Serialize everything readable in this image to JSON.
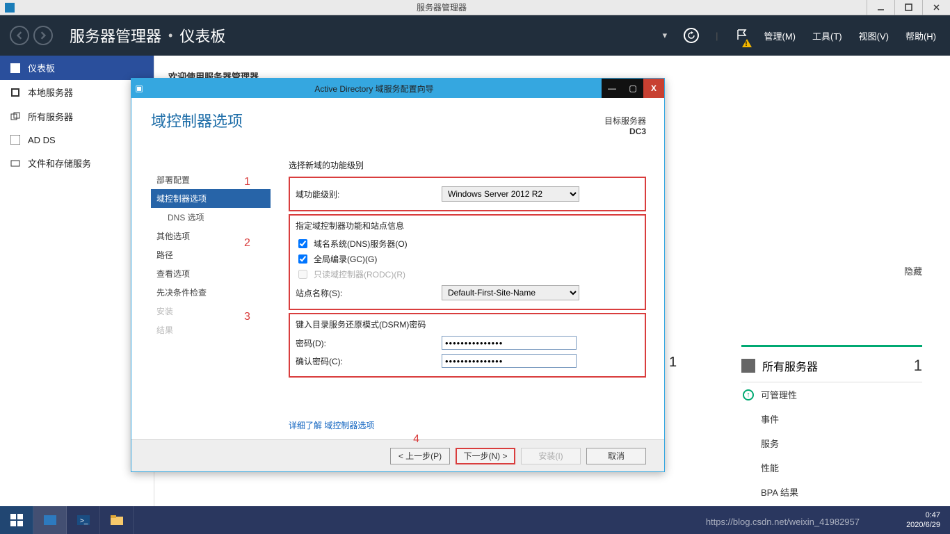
{
  "os_title": "服务器管理器",
  "header": {
    "app": "服务器管理器",
    "page": "仪表板",
    "menus": {
      "manage": "管理(M)",
      "tools": "工具(T)",
      "view": "视图(V)",
      "help": "帮助(H)"
    }
  },
  "sidebar": {
    "items": [
      {
        "label": "仪表板",
        "active": true
      },
      {
        "label": "本地服务器",
        "active": false
      },
      {
        "label": "所有服务器",
        "active": false
      },
      {
        "label": "AD DS",
        "active": false
      },
      {
        "label": "文件和存储服务",
        "active": false,
        "has_chevron": true
      }
    ]
  },
  "welcome": "欢迎使用服务器管理器",
  "hide_label": "隐藏",
  "tile": {
    "title": "所有服务器",
    "count": "1",
    "rows": {
      "r1": "可管理性",
      "r2": "事件",
      "r3": "服务",
      "r4": "性能",
      "r5": "BPA 结果"
    }
  },
  "wizard": {
    "title": "Active Directory 域服务配置向导",
    "heading": "域控制器选项",
    "target_label": "目标服务器",
    "target_server": "DC3",
    "nav": [
      "部署配置",
      "域控制器选项",
      "DNS 选项",
      "其他选项",
      "路径",
      "查看选项",
      "先决条件检查",
      "安装",
      "结果"
    ],
    "section1_title": "选择新域的功能级别",
    "domain_func_label": "域功能级别:",
    "domain_func_value": "Windows Server 2012 R2",
    "section2_title": "指定域控制器功能和站点信息",
    "cb_dns": "域名系统(DNS)服务器(O)",
    "cb_gc": "全局编录(GC)(G)",
    "cb_rodc": "只读域控制器(RODC)(R)",
    "site_label": "站点名称(S):",
    "site_value": "Default-First-Site-Name",
    "section3_title": "键入目录服务还原模式(DSRM)密码",
    "pwd_label": "密码(D):",
    "pwd_confirm_label": "确认密码(C):",
    "pwd_value": "•••••••••••••••",
    "link": "详细了解 域控制器选项",
    "btn_prev": "< 上一步(P)",
    "btn_next": "下一步(N) >",
    "btn_install": "安装(I)",
    "btn_cancel": "取消",
    "annotation": {
      "n1": "1",
      "n2": "2",
      "n3": "3",
      "n4": "4"
    }
  },
  "taskbar": {
    "time": "0:47",
    "date": "2020/6/29"
  },
  "watermark": "https://blog.csdn.net/weixin_41982957",
  "count_behind": "1"
}
